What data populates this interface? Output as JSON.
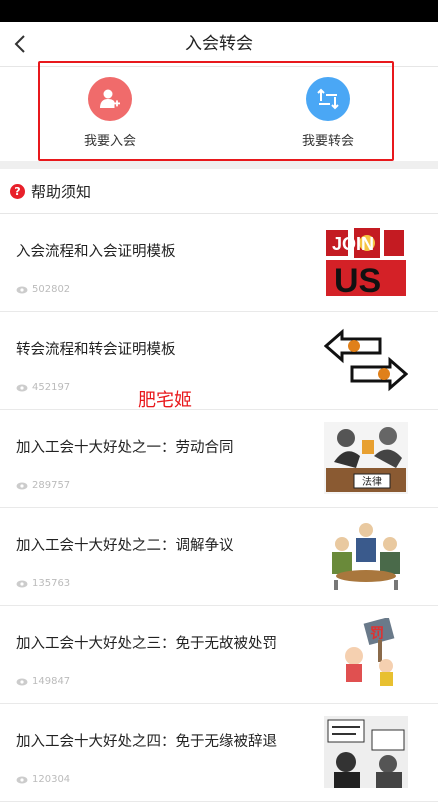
{
  "nav": {
    "title": "入会转会"
  },
  "actions": [
    {
      "label": "我要入会",
      "icon": "add-user-icon",
      "color": "#f06b6b"
    },
    {
      "label": "我要转会",
      "icon": "swap-arrows-icon",
      "color": "#4aa7f5"
    }
  ],
  "help": {
    "title": "帮助须知"
  },
  "articles": [
    {
      "title": "入会流程和入会证明模板",
      "views": "502802"
    },
    {
      "title": "转会流程和转会证明模板",
      "views": "452197"
    },
    {
      "title": "加入工会十大好处之一：劳动合同",
      "views": "289757"
    },
    {
      "title": "加入工会十大好处之二：调解争议",
      "views": "135763"
    },
    {
      "title": "加入工会十大好处之三：免于无故被处罚",
      "views": "149847"
    },
    {
      "title": "加入工会十大好处之四：免于无缘被辞退",
      "views": "120304"
    }
  ],
  "thumb_text": {
    "join": "JOIN",
    "us": "US",
    "law": "法律",
    "fine": "罚"
  },
  "watermark": "肥宅姬",
  "colors": {
    "accent_red": "#e8181c",
    "join_red": "#f06b6b",
    "transfer_blue": "#4aa7f5"
  }
}
